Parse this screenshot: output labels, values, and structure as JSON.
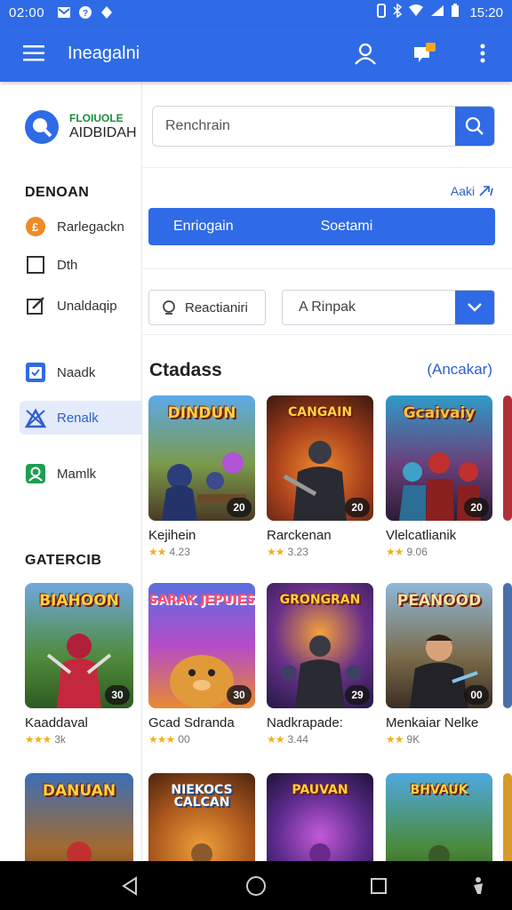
{
  "status_bar": {
    "time": "02:00",
    "clock": "15:20"
  },
  "app_bar": {
    "title": "Ineagalni"
  },
  "brand": {
    "line1": "FLOIUOLE",
    "line2": "AIDBIDAH"
  },
  "sidebar": {
    "section1": "DENOAN",
    "items": [
      {
        "label": "Rarlegackn",
        "icon": "coin-icon"
      },
      {
        "label": "Dth",
        "icon": "checkbox-icon"
      },
      {
        "label": "Unaldaqip",
        "icon": "edit-icon"
      },
      {
        "label": "Naadk",
        "icon": "calendar-icon"
      },
      {
        "label": "Renalk",
        "icon": "shapes-icon"
      },
      {
        "label": "Mamlk",
        "icon": "user-icon"
      }
    ],
    "section2": "GATERCIB",
    "game": {
      "title_art": "BIAHOON",
      "name": "Kaaddaval",
      "rating": "3k",
      "badge": "30"
    },
    "game2": {
      "title_art": "DANUAN"
    }
  },
  "search": {
    "value": "Renchrain"
  },
  "add_link": "Aaki",
  "tabs": [
    "Enriogain",
    "Soetami"
  ],
  "filter": {
    "button": "Reactianiri",
    "select_value": "A Rinpak"
  },
  "section": {
    "title": "Ctadass",
    "link": "(Ancakar)"
  },
  "games_row1": [
    {
      "title_art": "DINDUN",
      "name": "Kejihein",
      "rating": "4.23",
      "badge": "20"
    },
    {
      "title_art": "CANGAIN",
      "name": "Rarckenan",
      "rating": "3.23",
      "badge": "20"
    },
    {
      "title_art": "Gcaivaiy",
      "name": "Vlelcatlianik",
      "rating": "9.06",
      "badge": "20"
    }
  ],
  "games_row2": [
    {
      "title_art": "SARAK JEPUIES",
      "name": "Gcad Sdranda",
      "rating": "00",
      "badge": "30"
    },
    {
      "title_art": "GRONGRAN",
      "name": "Nadkrapade:",
      "rating": "3.44",
      "badge": "29"
    },
    {
      "title_art": "PEANOOD",
      "name": "Menkaiar Nelke",
      "rating": "9K",
      "badge": "00"
    }
  ],
  "games_row3": [
    {
      "title_art": "NIEKOCS CALCAN"
    },
    {
      "title_art": "PAUVAN"
    },
    {
      "title_art": "BHVAUK"
    }
  ]
}
